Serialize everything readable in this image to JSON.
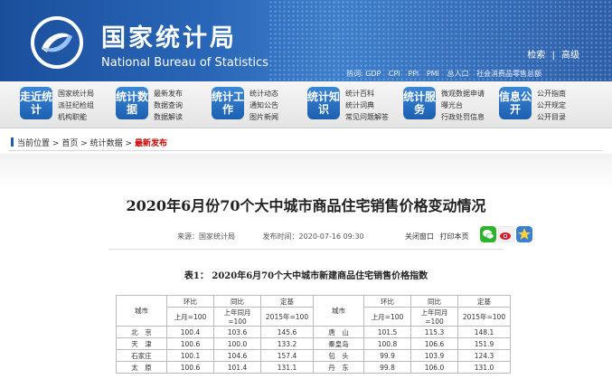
{
  "header": {
    "title_cn": "国家统计局",
    "title_en": "National Bureau of Statistics",
    "links": [
      "检索",
      "|",
      "高级"
    ],
    "hotwords": [
      "热词: GDP",
      "CPI",
      "PPI",
      "PMI",
      "总人口",
      "社会消费品零售总额"
    ]
  },
  "nav": [
    {
      "badge": "走近统计",
      "links": [
        "国家统计局",
        "派驻纪检组",
        "机构职能"
      ]
    },
    {
      "badge": "统计数据",
      "links": [
        "最新发布",
        "数据查询",
        "数据解读"
      ]
    },
    {
      "badge": "统计工作",
      "links": [
        "统计动态",
        "通知公告",
        "图片新闻"
      ]
    },
    {
      "badge": "统计知识",
      "links": [
        "统计百科",
        "统计词典",
        "常见问题解答"
      ]
    },
    {
      "badge": "统计服务",
      "links": [
        "微观数据申请",
        "曝光台",
        "行政处罚信息"
      ]
    },
    {
      "badge": "信息公开",
      "links": [
        "公开指南",
        "公开规定",
        "公开目录"
      ]
    }
  ],
  "breadcrumb": {
    "label": "当前位置",
    "items": [
      "首页",
      "统计数据"
    ],
    "current": "最新发布",
    "sep": ">"
  },
  "article": {
    "title": "2020年6月份70个大中城市商品住宅销售价格变动情况",
    "source": "来源：国家统计局",
    "publish_time": "发布时间：2020-07-16 09:30",
    "close": "关闭窗口",
    "print": "打印本页"
  },
  "table": {
    "caption": "表1：  2020年6月70个大中城市新建商品住宅销售价格指数",
    "city_header": "城市",
    "col_groups": [
      "环比",
      "同比",
      "定基"
    ],
    "col_subs": [
      "上月=100",
      "上年同月=100",
      "2015年=100"
    ],
    "rows": [
      [
        "北　京",
        "100.4",
        "103.6",
        "145.6",
        "唐　山",
        "101.5",
        "115.3",
        "148.1"
      ],
      [
        "天　津",
        "100.6",
        "100.0",
        "133.2",
        "秦皇岛",
        "100.8",
        "106.6",
        "151.9"
      ],
      [
        "石家庄",
        "100.1",
        "104.6",
        "157.4",
        "包　头",
        "99.9",
        "103.9",
        "124.3"
      ],
      [
        "太　原",
        "100.6",
        "101.4",
        "131.1",
        "丹　东",
        "99.8",
        "106.0",
        "131.0"
      ]
    ]
  },
  "colors": {
    "brand_blue": "#1c5fb0",
    "current_red": "#cc0000"
  }
}
